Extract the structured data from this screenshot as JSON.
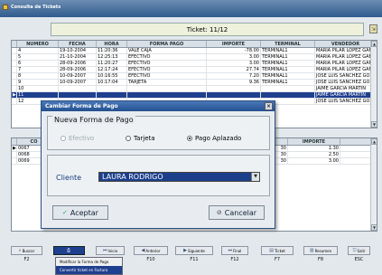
{
  "window": {
    "title": "Consulta de Tickets"
  },
  "header": {
    "ticket_label": "Ticket: 11/12"
  },
  "top_grid": {
    "columns": [
      "NUMERO",
      "FECHA",
      "HORA",
      "FORMA PAGO",
      "IMPORTE",
      "TERMINAL",
      "VENDEDOR"
    ],
    "rows": [
      [
        "4",
        "19-10-2004",
        "11:20:36",
        "VALE CAJA",
        "-78.00",
        "TERMINAL1",
        "MARIA PILAR LOPEZ GAF"
      ],
      [
        "5",
        "21-10-2004",
        "12:25:13",
        "EFECTIVO",
        "3.00",
        "TERMINAL1",
        "MARIA PILAR LOPEZ GAF"
      ],
      [
        "6",
        "28-09-2006",
        "11:20:27",
        "EFECTIVO",
        "3.00",
        "TERMINAL1",
        "MARIA PILAR LOPEZ GAF"
      ],
      [
        "7",
        "28-09-2006",
        "12:17:24",
        "EFECTIVO",
        "27.74",
        "TERMINAL1",
        "MARIA PILAR LOPEZ GAF"
      ],
      [
        "8",
        "10-09-2007",
        "10:16:55",
        "EFECTIVO",
        "7.20",
        "TERMINAL1",
        "JOSE LUIS SANCHEZ GO"
      ],
      [
        "9",
        "10-09-2007",
        "10:17:04",
        "TARJETA",
        "9.36",
        "TERMINAL1",
        "JOSE LUIS SANCHEZ GO"
      ],
      [
        "10",
        "",
        "",
        "",
        "",
        "",
        "JAIME GARCIA MARTIN"
      ],
      [
        "11",
        "",
        "",
        "",
        "",
        "",
        "JAIME GARCIA MARTIN"
      ],
      [
        "12",
        "",
        "",
        "",
        "",
        "",
        "JOSE LUIS SANCHEZ GO"
      ]
    ]
  },
  "bottom_grid": {
    "columns": [
      "CO",
      "",
      "IMPORTE"
    ],
    "rows": [
      [
        "0067",
        "30",
        "1.30"
      ],
      [
        "0068",
        "30",
        "2.50"
      ],
      [
        "0069",
        "30",
        "3.00"
      ]
    ]
  },
  "dialog": {
    "title": "Cambiar Forma de Pago",
    "group_label": "Nueva Forma de Pago",
    "radio_efectivo": "Efectivo",
    "radio_tarjeta": "Tarjeta",
    "radio_aplazado": "Pago Aplazado",
    "selected": "Pago Aplazado",
    "cliente_label": "Cliente",
    "cliente_value": "LAURA RODRIGO",
    "ok_label": "Aceptar",
    "cancel_label": "Cancelar"
  },
  "toolbar": {
    "buttons": [
      {
        "label": "Buscar",
        "key": "F2"
      },
      {
        "label": "",
        "key": ""
      },
      {
        "label": "Inicio",
        "key": ""
      },
      {
        "label": "Anterior",
        "key": "F10"
      },
      {
        "label": "Siguiente",
        "key": "F11"
      },
      {
        "label": "Final",
        "key": "F12"
      },
      {
        "label": "Ticket",
        "key": "F7"
      },
      {
        "label": "Resumen",
        "key": "F8"
      },
      {
        "label": "Salir",
        "key": "ESC"
      }
    ]
  },
  "popup_menu": {
    "item1": "Modificar la Forma de Pago",
    "item2": "Convertir ticket en Factura"
  }
}
